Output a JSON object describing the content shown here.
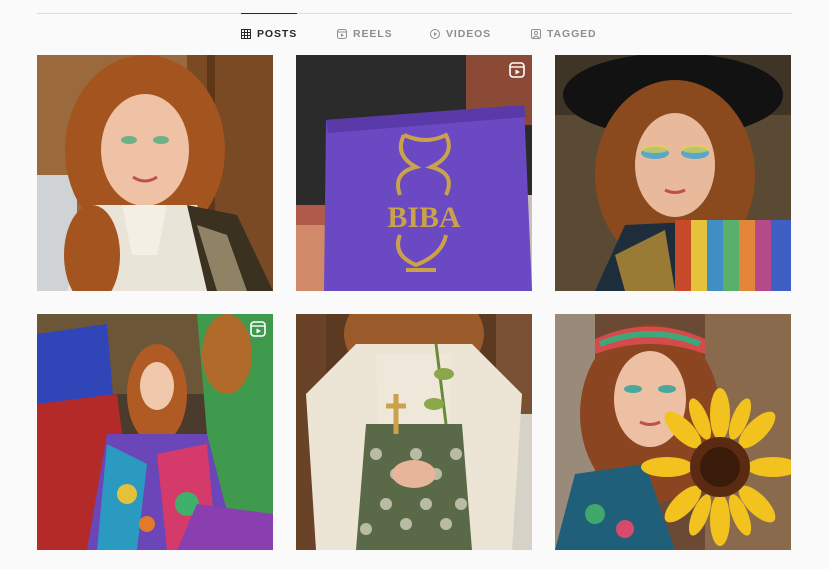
{
  "tabs": [
    {
      "label": "POSTS",
      "icon": "grid-icon",
      "active": true
    },
    {
      "label": "REELS",
      "icon": "reels-icon",
      "active": false
    },
    {
      "label": "VIDEOS",
      "icon": "play-circle-icon",
      "active": false
    },
    {
      "label": "TAGGED",
      "icon": "tag-user-icon",
      "active": false
    }
  ],
  "posts": [
    {
      "kind": "photo",
      "subject": "selfie-lace-blouse",
      "is_reel": false
    },
    {
      "kind": "photo",
      "subject": "purple-book",
      "book_title": "BIBA",
      "is_reel": true
    },
    {
      "kind": "photo",
      "subject": "selfie-black-hat",
      "is_reel": false
    },
    {
      "kind": "photo",
      "subject": "group-retro-fashion",
      "is_reel": true
    },
    {
      "kind": "photo",
      "subject": "lace-blouse-brocade-dress",
      "is_reel": false
    },
    {
      "kind": "photo",
      "subject": "selfie-sunflower",
      "is_reel": false
    }
  ],
  "colors": {
    "background": "#fafafa",
    "divider": "#dbdbdb",
    "tab_active": "#262626",
    "tab_inactive": "#8e8e8e",
    "book_purple": "#6a49c2",
    "book_gold": "#c9a24a"
  }
}
